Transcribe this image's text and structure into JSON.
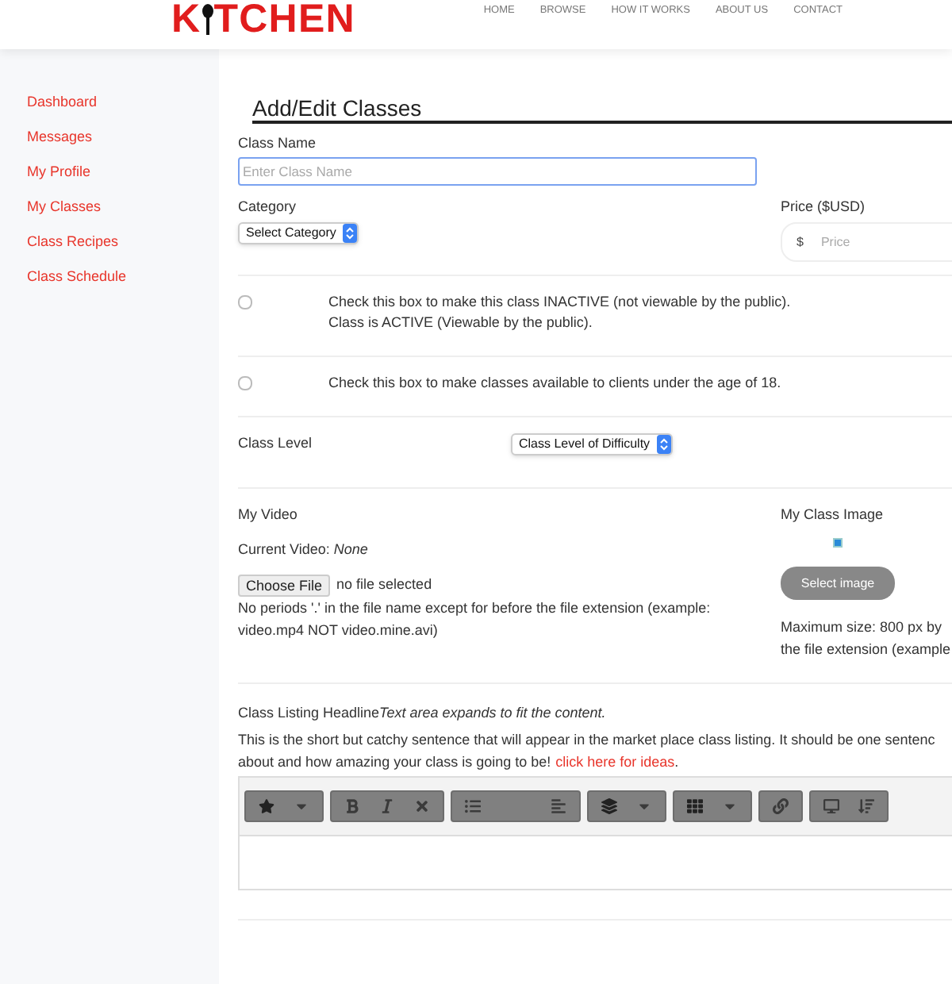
{
  "logo": {
    "before": "K",
    "after": "TCHEN"
  },
  "nav": [
    "HOME",
    "BROWSE",
    "HOW IT WORKS",
    "ABOUT US",
    "CONTACT"
  ],
  "sidebar": {
    "items": [
      {
        "label": "Dashboard"
      },
      {
        "label": "Messages"
      },
      {
        "label": "My Profile"
      },
      {
        "label": "My Classes"
      },
      {
        "label": "Class Recipes"
      },
      {
        "label": "Class Schedule"
      }
    ]
  },
  "title": "Add/Edit Classes",
  "class_name": {
    "label": "Class Name",
    "placeholder": "Enter Class Name"
  },
  "category": {
    "label": "Category",
    "value": "Select Category"
  },
  "price": {
    "label": "Price ($USD)",
    "prefix": "$",
    "placeholder": "Price"
  },
  "checkboxes": [
    {
      "checked": false,
      "lines": [
        "Check this box to make this class INACTIVE (not viewable by the public).",
        "Class is ACTIVE (Viewable by the public)."
      ]
    },
    {
      "checked": false,
      "lines": [
        "Check this box to make classes available to clients under the age of 18."
      ]
    }
  ],
  "class_level": {
    "label": "Class Level",
    "value": "Class Level of Difficulty"
  },
  "video": {
    "label": "My Video",
    "current": "Current Video: *None*",
    "button": "Choose File",
    "status": "no file selected",
    "note": "No periods '.' in the file name except for before the file extension (example: video.mp4 NOT video.mine.avi)"
  },
  "image": {
    "label": "My Class Image",
    "button": "Select image",
    "note_lines": [
      "Maximum size: 800 px by",
      "the file extension (example"
    ]
  },
  "headline": {
    "label": "Class Listing Headline",
    "hint": "Text area expands to fit the content.",
    "help_lines": [
      "This is the short but catchy sentence that will appear in the market place class listing. It should be one sentenc",
      "about and how amazing your class is going to be!"
    ],
    "link": "click here for ideas",
    "after_link": "."
  }
}
